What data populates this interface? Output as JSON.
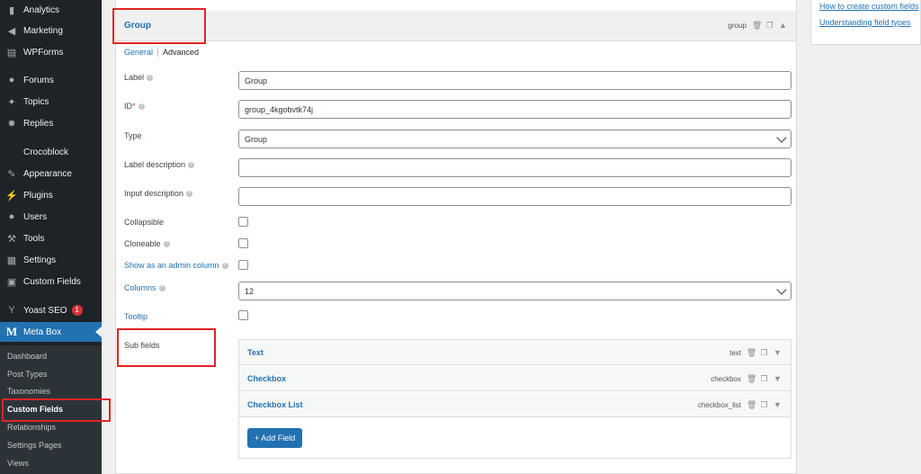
{
  "sidebar": {
    "items": [
      {
        "label": "Analytics",
        "icon": "bar-chart-icon"
      },
      {
        "label": "Marketing",
        "icon": "megaphone-icon"
      },
      {
        "label": "WPForms",
        "icon": "form-icon"
      },
      {
        "label": "Forums",
        "icon": "forums-icon"
      },
      {
        "label": "Topics",
        "icon": "topics-icon"
      },
      {
        "label": "Replies",
        "icon": "replies-icon"
      },
      {
        "label": "Crocoblock",
        "icon": ""
      },
      {
        "label": "Appearance",
        "icon": "paintbrush-icon"
      },
      {
        "label": "Plugins",
        "icon": "plugin-icon"
      },
      {
        "label": "Users",
        "icon": "user-icon"
      },
      {
        "label": "Tools",
        "icon": "wrench-icon"
      },
      {
        "label": "Settings",
        "icon": "settings-icon"
      },
      {
        "label": "Custom Fields",
        "icon": "custom-fields-icon"
      },
      {
        "label": "Yoast SEO",
        "icon": "yoast-icon",
        "badge": "1"
      },
      {
        "label": "Meta Box",
        "icon": "metabox-icon"
      }
    ],
    "submenu": [
      "Dashboard",
      "Post Types",
      "Taxonomies",
      "Custom Fields",
      "Relationships",
      "Settings Pages",
      "Views"
    ]
  },
  "group": {
    "title": "Group",
    "type_tag": "group",
    "tabs": [
      "General",
      "Advanced"
    ]
  },
  "fields": {
    "label": {
      "label": "Label",
      "value": "Group"
    },
    "id": {
      "label": "ID",
      "required_mark": "*",
      "value": "group_4kgobvtk74j"
    },
    "type": {
      "label": "Type",
      "value": "Group"
    },
    "label_description": {
      "label": "Label description",
      "value": ""
    },
    "input_description": {
      "label": "Input description",
      "value": ""
    },
    "collapsible": {
      "label": "Collapsible"
    },
    "cloneable": {
      "label": "Cloneable"
    },
    "admin_column": {
      "label": "Show as an admin column"
    },
    "columns": {
      "label": "Columns",
      "value": "12"
    },
    "tooltip": {
      "label": "Tooltip"
    },
    "sub_fields": {
      "label": "Sub fields"
    }
  },
  "subfields": [
    {
      "name": "Text",
      "type": "text"
    },
    {
      "name": "Checkbox",
      "type": "checkbox"
    },
    {
      "name": "Checkbox List",
      "type": "checkbox_list"
    }
  ],
  "add_field_label": "+ Add Field",
  "right_panel": {
    "links": [
      "How to create custom fields",
      "Understanding field types"
    ]
  },
  "colors": {
    "accent": "#2271b1",
    "highlight": "#e02424",
    "sidebar": "#1d2327"
  }
}
